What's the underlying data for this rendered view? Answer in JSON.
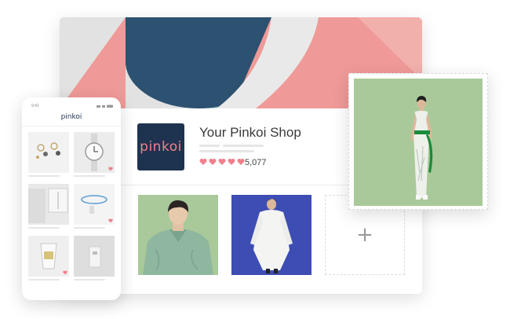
{
  "shop": {
    "name": "Your Pinkoi Shop",
    "logo_text": "pinkoi",
    "rating_count": "5,077",
    "stars": 5,
    "add_symbol": "+"
  },
  "phone": {
    "time": "9:41",
    "logo_text": "pinkoi"
  },
  "colors": {
    "navy": "#1e3350",
    "pink": "#f0808a",
    "banner_pink": "#ef9a98",
    "mint": "#b2dcd8",
    "sage": "#a9c99a",
    "blue_bg": "#3d4db3"
  },
  "icons": [
    "heart-icon",
    "plus-icon",
    "signal-icon",
    "wifi-icon",
    "battery-icon"
  ]
}
